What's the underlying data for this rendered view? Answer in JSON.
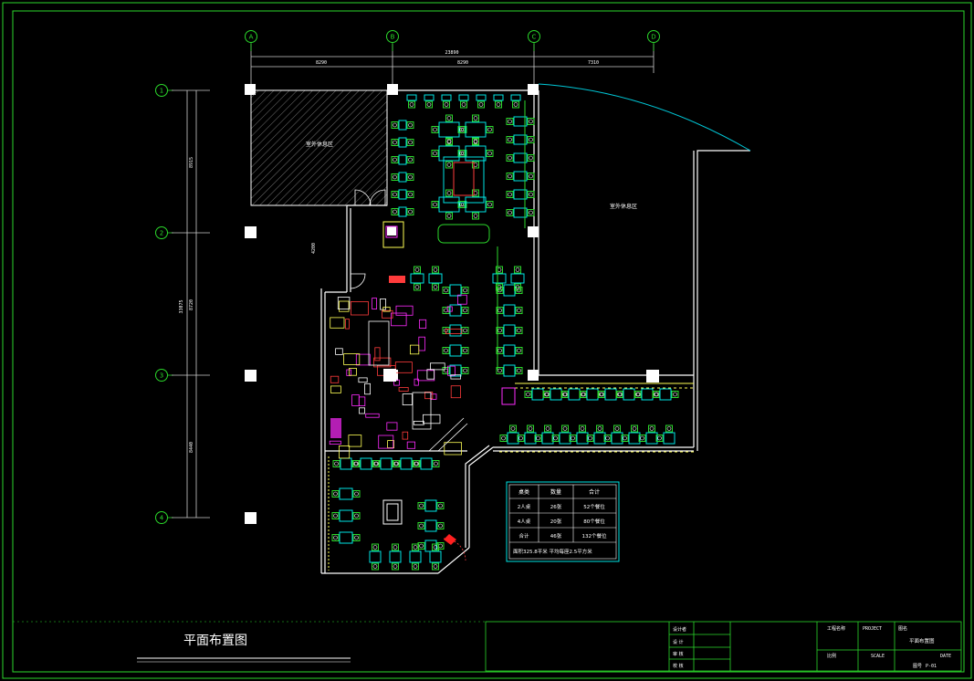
{
  "drawing": {
    "title": "平面布置图",
    "areas": {
      "left_room": "室外休息区",
      "right_room": "室外休息区"
    },
    "grid": {
      "columns": [
        "A",
        "B",
        "C",
        "D"
      ],
      "rows": [
        "1",
        "2",
        "3",
        "4"
      ]
    },
    "dimensions": {
      "top_total": "23890",
      "top_segments": [
        "8290",
        "8290",
        "7310"
      ],
      "left_total": "33075",
      "left_segments": [
        "8915",
        "8720",
        "8440"
      ],
      "corridor": "4200"
    },
    "legend": {
      "headers": [
        "桌类",
        "数量",
        "合计"
      ],
      "rows": [
        [
          "2人桌",
          "26张",
          "52个餐位"
        ],
        [
          "4人桌",
          "20张",
          "80个餐位"
        ],
        [
          "合计",
          "46张",
          "132个餐位"
        ]
      ],
      "note": "面积325.8平米  平均每座2.5平方米"
    }
  },
  "title_block": {
    "labels": [
      "设计者",
      "设 计",
      "审 核",
      "校 核"
    ],
    "project_label": "工程名称",
    "project_value": "PROJECT",
    "drawing_label": "图名",
    "drawing_value": "平面布置图",
    "scale_label": "比例",
    "scale_value": "SCALE",
    "date_label": "日期",
    "date_value": "DATE",
    "sheet_label": "图号",
    "sheet_value": "P-01"
  },
  "colors": {
    "frame": "#2bd82b",
    "wall": "#ffffff",
    "furniture": "#00e5e5",
    "hatch": "#8a8a8a",
    "kitchen": "#ff3b3b",
    "equipment": "#ff2bff",
    "accent": "#ffff55"
  }
}
